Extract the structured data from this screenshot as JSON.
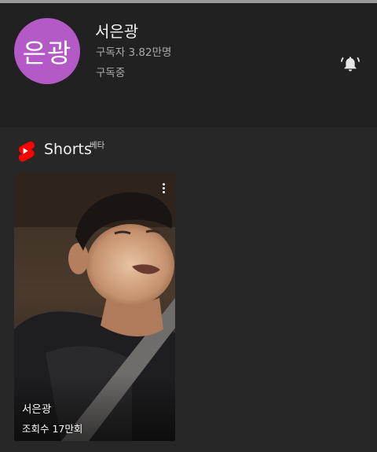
{
  "channel": {
    "avatar_text": "은광",
    "name": "서은광",
    "subscribers": "구독자 3.82만명",
    "subscribed_label": "구독중",
    "avatar_color": "#b45ac6",
    "notification_icon": "bell-ringing-icon"
  },
  "shorts": {
    "section_title": "Shorts",
    "beta_label": "베타",
    "logo_icon": "youtube-shorts-logo",
    "accent_color": "#ff0000",
    "items": [
      {
        "title": "서은광",
        "views": "조회수 17만회",
        "menu_icon": "more-vert-icon"
      }
    ]
  }
}
